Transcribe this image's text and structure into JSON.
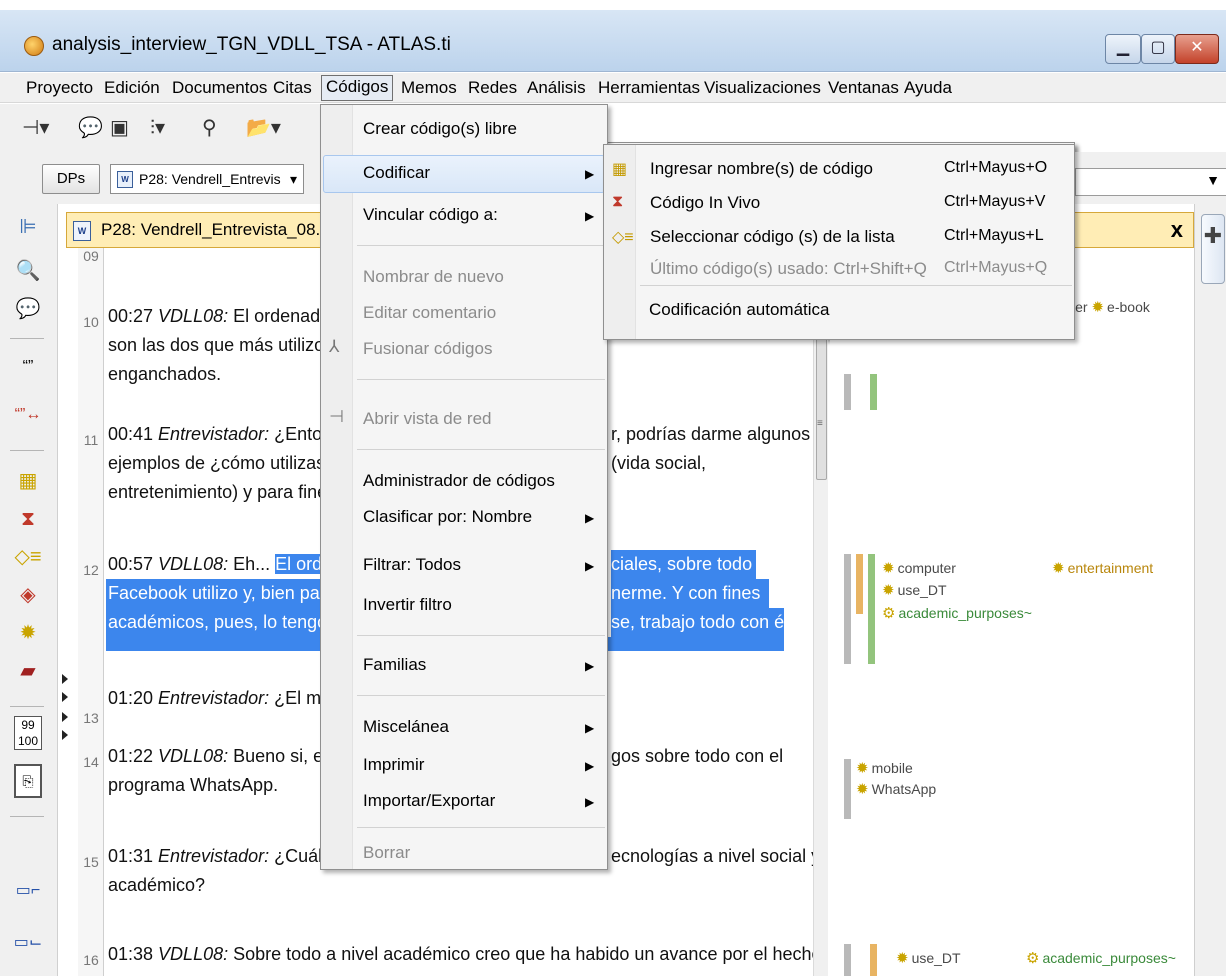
{
  "window": {
    "title": "analysis_interview_TGN_VDLL_TSA - ATLAS.ti"
  },
  "menubar": [
    "Proyecto",
    "Edición",
    "Documentos",
    "Citas",
    "Códigos",
    "Memos",
    "Redes",
    "Análisis",
    "Herramientas",
    "Visualizaciones",
    "Ventanas",
    "Ayuda"
  ],
  "row2": {
    "dps_label": "DPs",
    "doc_select": "P28: Vendrell_Entrevis",
    "doc_icon_text": "W"
  },
  "document": {
    "header_title": "P28: Vendrell_Entrevista_08.",
    "line_numbers": [
      "09",
      "10",
      "11",
      "12",
      "13",
      "14",
      "15",
      "16"
    ],
    "lines": {
      "l10a_pre": "00:27 ",
      "l10a_sp": "VDLL08:",
      "l10a_post": " El ordenador",
      "l10b": "son las dos que más utilizo.",
      "l10c": "enganchados.",
      "l11a_pre": "00:41 ",
      "l11a_sp": "Entrevistador:",
      "l11a_post": " ¿Enton",
      "l11a_tail": "r, podrías darme algunos",
      "l11b": "ejemplos de ¿cómo utilizas",
      "l11b_tail": "(vida social,",
      "l11c": "entretenimiento) y para fines",
      "l12a_pre": "00:57 ",
      "l12a_sp": "VDLL08:",
      "l12a_post": " Eh... ",
      "l12a_hl": "El orde",
      "l12a_tail": "ciales, sobre todo",
      "l12b": "Facebook utilizo y, bien par",
      "l12b_tail": "nerme. Y con fines",
      "l12c": "académicos, pues, lo tengo",
      "l12c_tail": "se, trabajo todo con él.",
      "l13_pre": "01:20 ",
      "l13_sp": "Entrevistador:",
      "l13_post": " ¿El mó",
      "l14a_pre": "01:22 ",
      "l14a_sp": "VDLL08:",
      "l14a_post": " Bueno si, el",
      "l14a_tail": "gos sobre todo con el",
      "l14b": "programa WhatsApp.",
      "l15a_pre": "01:31 ",
      "l15a_sp": "Entrevistador:",
      "l15a_post": " ¿Cuále",
      "l15a_tail": "ecnologías a nivel social y",
      "l15b": "académico?",
      "l16_pre": "01:38 ",
      "l16_sp": "VDLL08:",
      "l16_post": " Sobre todo a nivel académico creo que ha habido un avance por el hecho"
    }
  },
  "margin": {
    "close": "x",
    "codes": {
      "computer_partial": "mputer",
      "ebook": "e-book",
      "computer": "computer",
      "entertainment": "entertainment",
      "use_dt": "use_DT",
      "academic": "academic_purposes~",
      "mobile": "mobile",
      "whatsapp": "WhatsApp",
      "use_dt2": "use_DT",
      "academic2": "academic_purposes~"
    }
  },
  "codigos_menu": {
    "items": [
      "Crear código(s) libre",
      "Codificar",
      "Vincular código a:",
      "Nombrar de nuevo",
      "Editar comentario",
      "Fusionar códigos",
      "Abrir vista de red",
      "Administrador de códigos",
      "Clasificar por: Nombre",
      "Filtrar: Todos",
      "Invertir filtro",
      "Familias",
      "Miscelánea",
      "Imprimir",
      "Importar/Exportar",
      "Borrar"
    ]
  },
  "codificar_submenu": {
    "items": [
      {
        "label": "Ingresar nombre(s) de código",
        "shortcut": "Ctrl+Mayus+O"
      },
      {
        "label": "Código In Vivo",
        "shortcut": "Ctrl+Mayus+V"
      },
      {
        "label": "Seleccionar código (s) de la lista",
        "shortcut": "Ctrl+Mayus+L"
      },
      {
        "label": "Último código(s) usado: Ctrl+Shift+Q",
        "shortcut": "Ctrl+Mayus+Q"
      },
      {
        "label": "Codificación automática",
        "shortcut": ""
      }
    ]
  },
  "colors": {
    "selection": "#3c86ed",
    "header_yellow": "#ffedb5",
    "bar_orange": "#e8b463",
    "bar_green": "#93c47d",
    "bar_gray": "#b9b9b9"
  }
}
